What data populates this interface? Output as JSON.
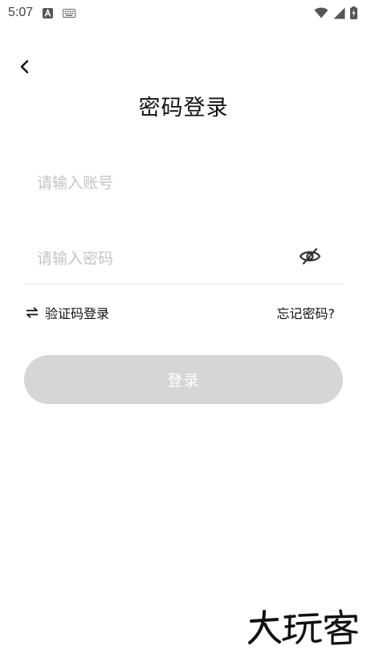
{
  "status_bar": {
    "time": "5:07",
    "icons": [
      "notification-a-icon",
      "keyboard-icon",
      "wifi-icon",
      "cell-signal-icon",
      "battery-charging-icon"
    ]
  },
  "navigation": {
    "back_icon": "back-arrow-icon"
  },
  "page": {
    "title": "密码登录"
  },
  "form": {
    "account": {
      "value": "",
      "placeholder": "请输入账号"
    },
    "password": {
      "value": "",
      "placeholder": "请输入密码",
      "toggle_icon": "eye-off-icon"
    },
    "switch_login": {
      "icon": "swap-icon",
      "label": "验证码登录"
    },
    "forgot_password": {
      "label": "忘记密码?"
    },
    "submit": {
      "label": "登录",
      "enabled": false
    }
  },
  "watermark": {
    "text": "大玩客"
  },
  "colors": {
    "button_disabled": "#d6d6d6",
    "button_text": "#ffffff",
    "placeholder": "#c4c4c4",
    "text": "#111111",
    "divider": "#ececec"
  }
}
